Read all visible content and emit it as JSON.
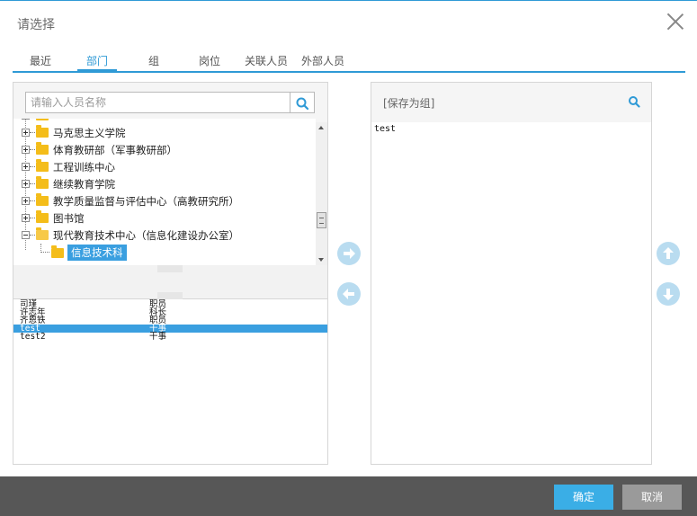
{
  "dialog": {
    "title": "请选择"
  },
  "tabs": [
    {
      "label": "最近"
    },
    {
      "label": "部门"
    },
    {
      "label": "组"
    },
    {
      "label": "岗位"
    },
    {
      "label": "关联人员"
    },
    {
      "label": "外部人员"
    }
  ],
  "active_tab": "部门",
  "search": {
    "placeholder": "请输入人员名称",
    "value": ""
  },
  "tree": {
    "items": [
      {
        "label": "马克思主义学院",
        "state": "collapsed"
      },
      {
        "label": "体育教研部（军事教研部）",
        "state": "collapsed"
      },
      {
        "label": "工程训练中心",
        "state": "collapsed"
      },
      {
        "label": "继续教育学院",
        "state": "collapsed"
      },
      {
        "label": "教学质量监督与评估中心（高教研究所）",
        "state": "collapsed"
      },
      {
        "label": "图书馆",
        "state": "collapsed"
      },
      {
        "label": "现代教育技术中心（信息化建设办公室）",
        "state": "expanded"
      }
    ],
    "selected_child": "信息技术科"
  },
  "people": [
    {
      "name": "司瑾",
      "position": "职员"
    },
    {
      "name": "许志年",
      "position": "科长"
    },
    {
      "name": "齐恩铁",
      "position": "职员"
    },
    {
      "name": "test",
      "position": "干事",
      "selected": true
    },
    {
      "name": "test2",
      "position": "干事"
    }
  ],
  "right": {
    "save_group_label": "[保存为组]",
    "items": [
      "test"
    ]
  },
  "footer": {
    "ok_label": "确定",
    "cancel_label": "取消"
  },
  "colors": {
    "accent": "#2f9ad6",
    "selection": "#3a9fe0",
    "footer_bg": "#575757",
    "ok_bg": "#3aaee6",
    "cancel_bg": "#9a9a9a"
  },
  "icons": [
    "close-icon",
    "search-icon",
    "folder-icon",
    "arrow-right-icon",
    "arrow-left-icon",
    "arrow-up-icon",
    "arrow-down-icon"
  ]
}
